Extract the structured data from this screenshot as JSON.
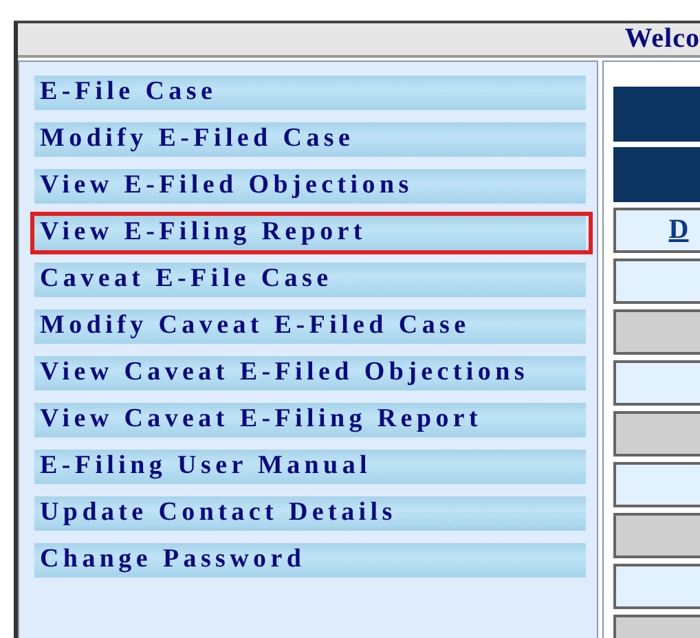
{
  "header": {
    "title": "Welco"
  },
  "menu": [
    {
      "label": "E-File Case",
      "highlighted": false
    },
    {
      "label": "Modify E-Filed Case",
      "highlighted": false
    },
    {
      "label": "View E-Filed Objections",
      "highlighted": false
    },
    {
      "label": "View E-Filing Report",
      "highlighted": true
    },
    {
      "label": "Caveat E-File Case",
      "highlighted": false
    },
    {
      "label": "Modify Caveat E-Filed Case",
      "highlighted": false
    },
    {
      "label": "View Caveat E-Filed Objections",
      "highlighted": false
    },
    {
      "label": "View Caveat E-Filing Report",
      "highlighted": false
    },
    {
      "label": "E-Filing User Manual",
      "highlighted": false
    },
    {
      "label": "Update Contact Details",
      "highlighted": false
    },
    {
      "label": "Change Password",
      "highlighted": false
    }
  ],
  "right_panel": {
    "cells": [
      {
        "kind": "link",
        "text": "D",
        "shaded": false
      },
      {
        "kind": "blank",
        "shaded": false
      },
      {
        "kind": "blank",
        "shaded": true
      },
      {
        "kind": "blank",
        "shaded": false
      },
      {
        "kind": "blank",
        "shaded": true
      },
      {
        "kind": "blank",
        "shaded": false
      },
      {
        "kind": "blank",
        "shaded": true
      },
      {
        "kind": "blank",
        "shaded": false
      },
      {
        "kind": "blank",
        "shaded": true
      }
    ]
  }
}
